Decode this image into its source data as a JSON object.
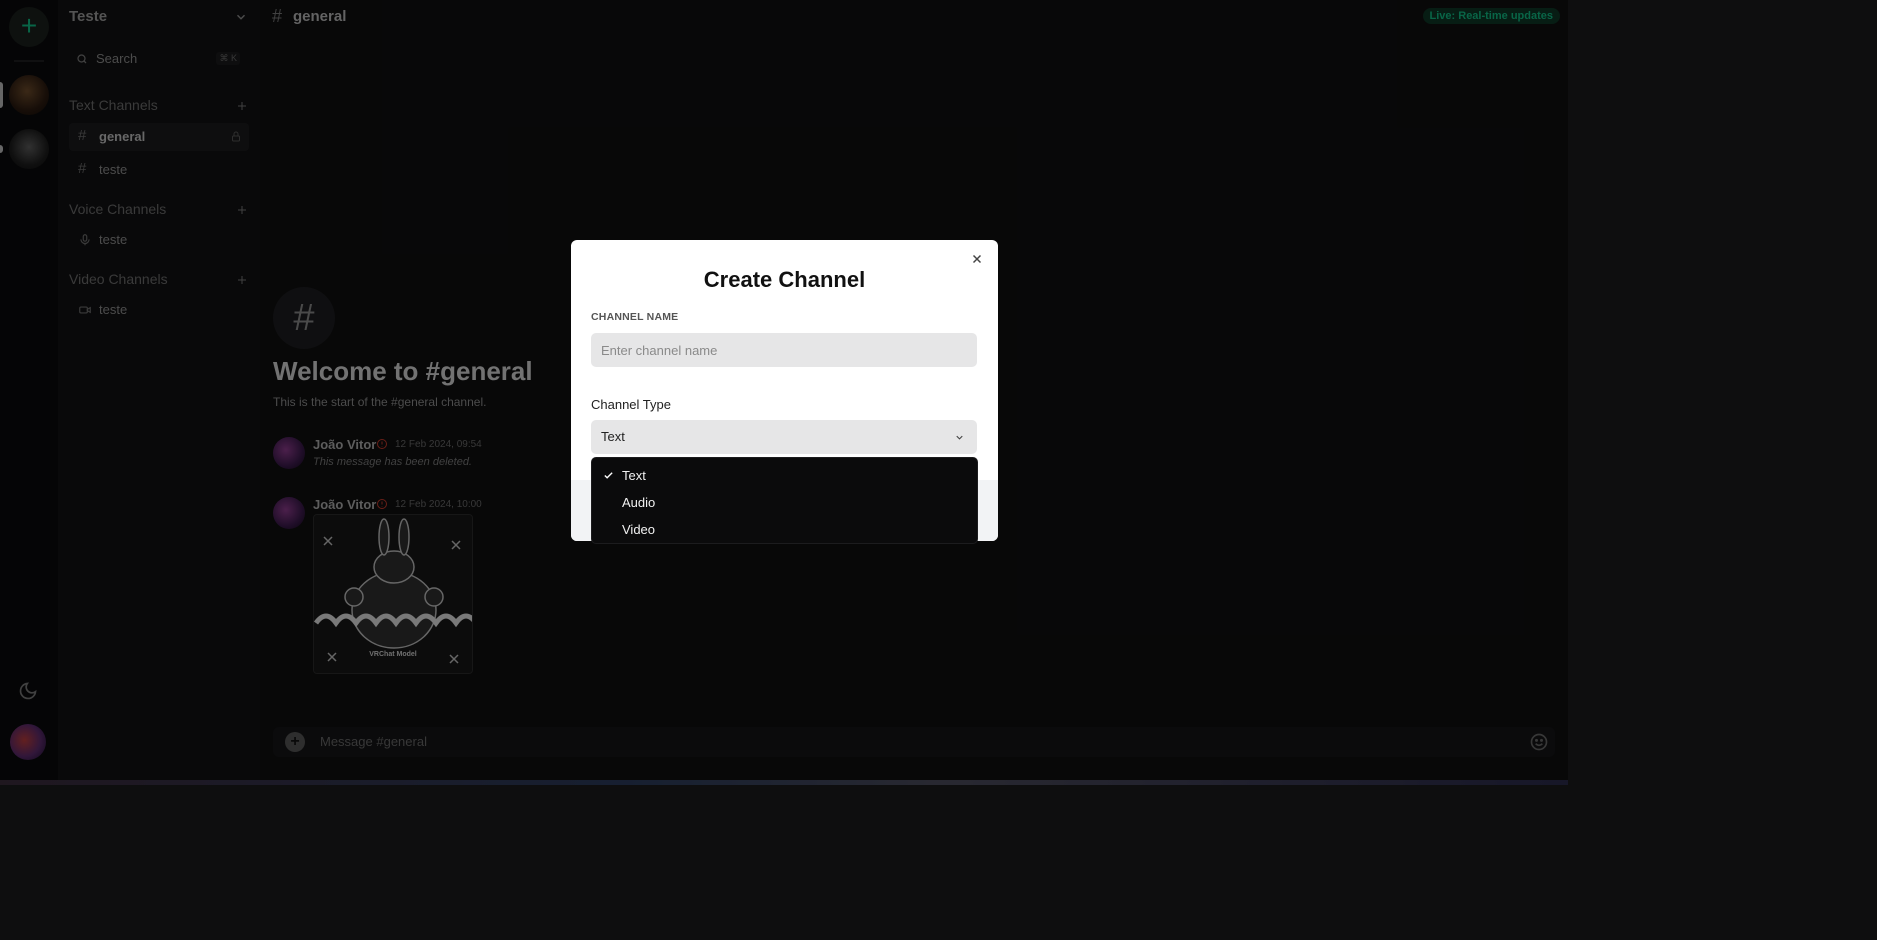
{
  "app": {
    "server_name": "Teste",
    "search": {
      "label": "Search",
      "shortcut": "⌘ K"
    },
    "sections": [
      {
        "title": "Text Channels",
        "channels": [
          {
            "name": "general",
            "active": true
          },
          {
            "name": "teste"
          }
        ]
      },
      {
        "title": "Voice Channels",
        "channels": [
          {
            "name": "teste"
          }
        ]
      },
      {
        "title": "Video Channels",
        "channels": [
          {
            "name": "teste"
          }
        ]
      }
    ]
  },
  "header": {
    "hash": "#",
    "channel": "general",
    "live_badge": "Live: Real-time updates"
  },
  "welcome": {
    "icon": "#",
    "title": "Welcome to #general",
    "subtitle": "This is the start of the #general channel."
  },
  "messages": [
    {
      "author": "João Vitor",
      "time": "12 Feb 2024, 09:54",
      "text": "This message has been deleted."
    },
    {
      "author": "João Vitor",
      "time": "12 Feb 2024, 10:00",
      "image_caption": "VRChat Model"
    }
  ],
  "composer": {
    "placeholder": "Message #general"
  },
  "modal": {
    "title": "Create Channel",
    "name_label": "CHANNEL NAME",
    "name_placeholder": "Enter channel name",
    "name_value": "",
    "type_label": "Channel Type",
    "type_value": "Text",
    "options": [
      "Text",
      "Audio",
      "Video"
    ],
    "selected_option": "Text"
  },
  "colors": {
    "accent": "#10b981",
    "modal_bg": "#ffffff",
    "dropdown_bg": "#0b0b0c",
    "role_icon": "#c0392b"
  }
}
